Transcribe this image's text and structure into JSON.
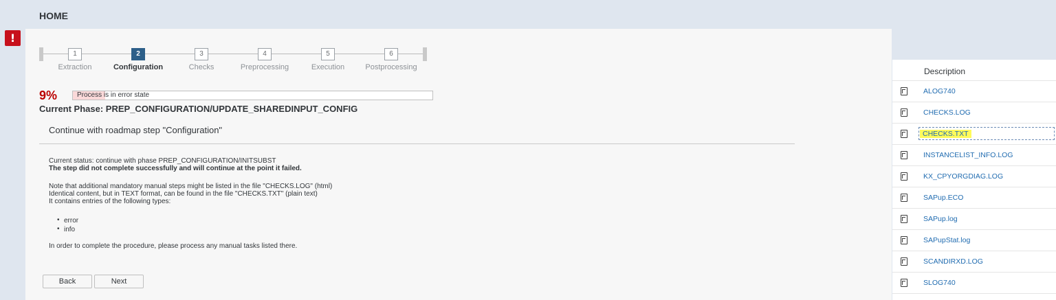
{
  "header": {
    "title": "HOME"
  },
  "roadmap": {
    "steps": [
      {
        "number": "1",
        "label": "Extraction"
      },
      {
        "number": "2",
        "label": "Configuration"
      },
      {
        "number": "3",
        "label": "Checks"
      },
      {
        "number": "4",
        "label": "Preprocessing"
      },
      {
        "number": "5",
        "label": "Execution"
      },
      {
        "number": "6",
        "label": "Postprocessing"
      }
    ],
    "active_step": 2
  },
  "progress": {
    "percent_text": "9%",
    "status_text": "Process is in error state",
    "value": 0.09,
    "fill_color": "#fbd9d9"
  },
  "phase": {
    "text": "Current Phase: PREP_CONFIGURATION/UPDATE_SHAREDINPUT_CONFIG"
  },
  "step_title": "Continue with roadmap step \"Configuration\"",
  "message": {
    "current_status": "Current status: continue with phase PREP_CONFIGURATION/INITSUBST",
    "failed": "The step did not complete successfully and will continue at the point it failed.",
    "note_line1": "Note that additional mandatory manual steps might be listed in the file \"CHECKS.LOG\" (html)",
    "note_line2": "Identical content, but in TEXT format, can be found in the file \"CHECKS.TXT\" (plain text)",
    "note_line3": "It contains entries of the following types:",
    "types": [
      "error",
      "info"
    ],
    "final": "In order to complete the procedure, please process any manual tasks listed there."
  },
  "buttons": {
    "back": "Back",
    "next": "Next"
  },
  "side": {
    "header": "Description",
    "files": [
      "ALOG740",
      "CHECKS.LOG",
      "CHECKS.TXT",
      "INSTANCELIST_INFO.LOG",
      "KX_CPYORGDIAG.LOG",
      "SAPup.ECO",
      "SAPup.log",
      "SAPupStat.log",
      "SCANDIRXD.LOG",
      "SLOG740"
    ],
    "selected": "CHECKS.TXT"
  },
  "colors": {
    "error": "#c7101c",
    "link": "#1f6bb0",
    "active_step": "#2d5f89",
    "highlight": "#fffb5a"
  }
}
